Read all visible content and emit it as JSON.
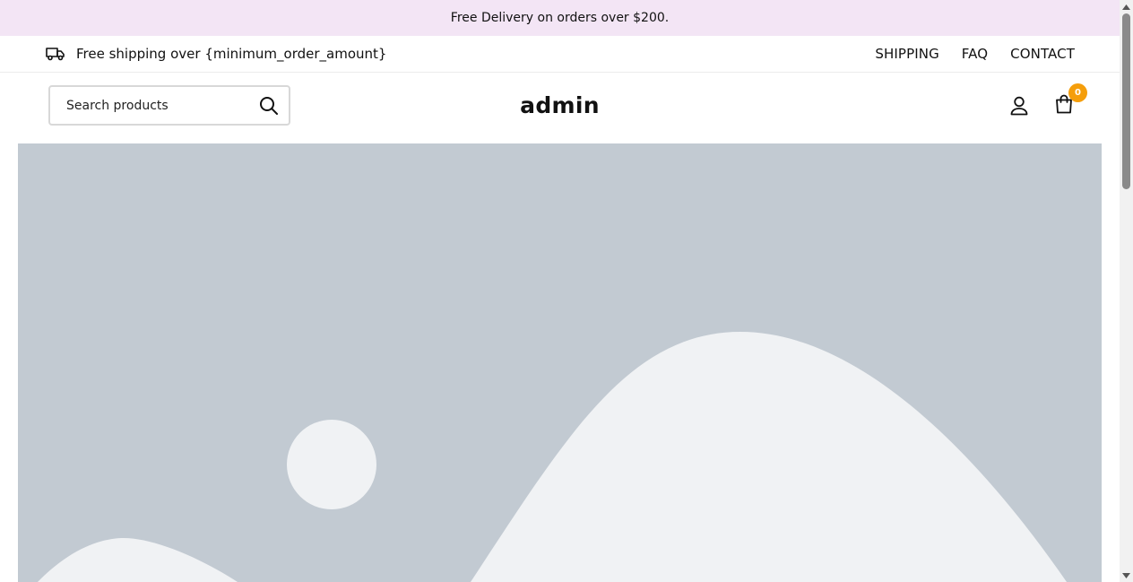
{
  "announcement": {
    "text": "Free Delivery on orders over $200."
  },
  "utility_bar": {
    "shipping_text": "Free shipping over {minimum_order_amount}",
    "shipping_icon": "truck-icon",
    "links": [
      {
        "label": "SHIPPING"
      },
      {
        "label": "FAQ"
      },
      {
        "label": "CONTACT"
      }
    ]
  },
  "header": {
    "search": {
      "placeholder": "Search products",
      "value": "",
      "icon": "search-icon"
    },
    "logo": "admin",
    "account_icon": "user-icon",
    "cart": {
      "icon": "shopping-bag-icon",
      "count": "0"
    }
  },
  "hero": {
    "image": "image-placeholder"
  },
  "colors": {
    "announcement_bg": "#f3e5f5",
    "badge": "#f59e0b",
    "placeholder_bg": "#c2cad2",
    "placeholder_fg": "#f0f2f4"
  }
}
